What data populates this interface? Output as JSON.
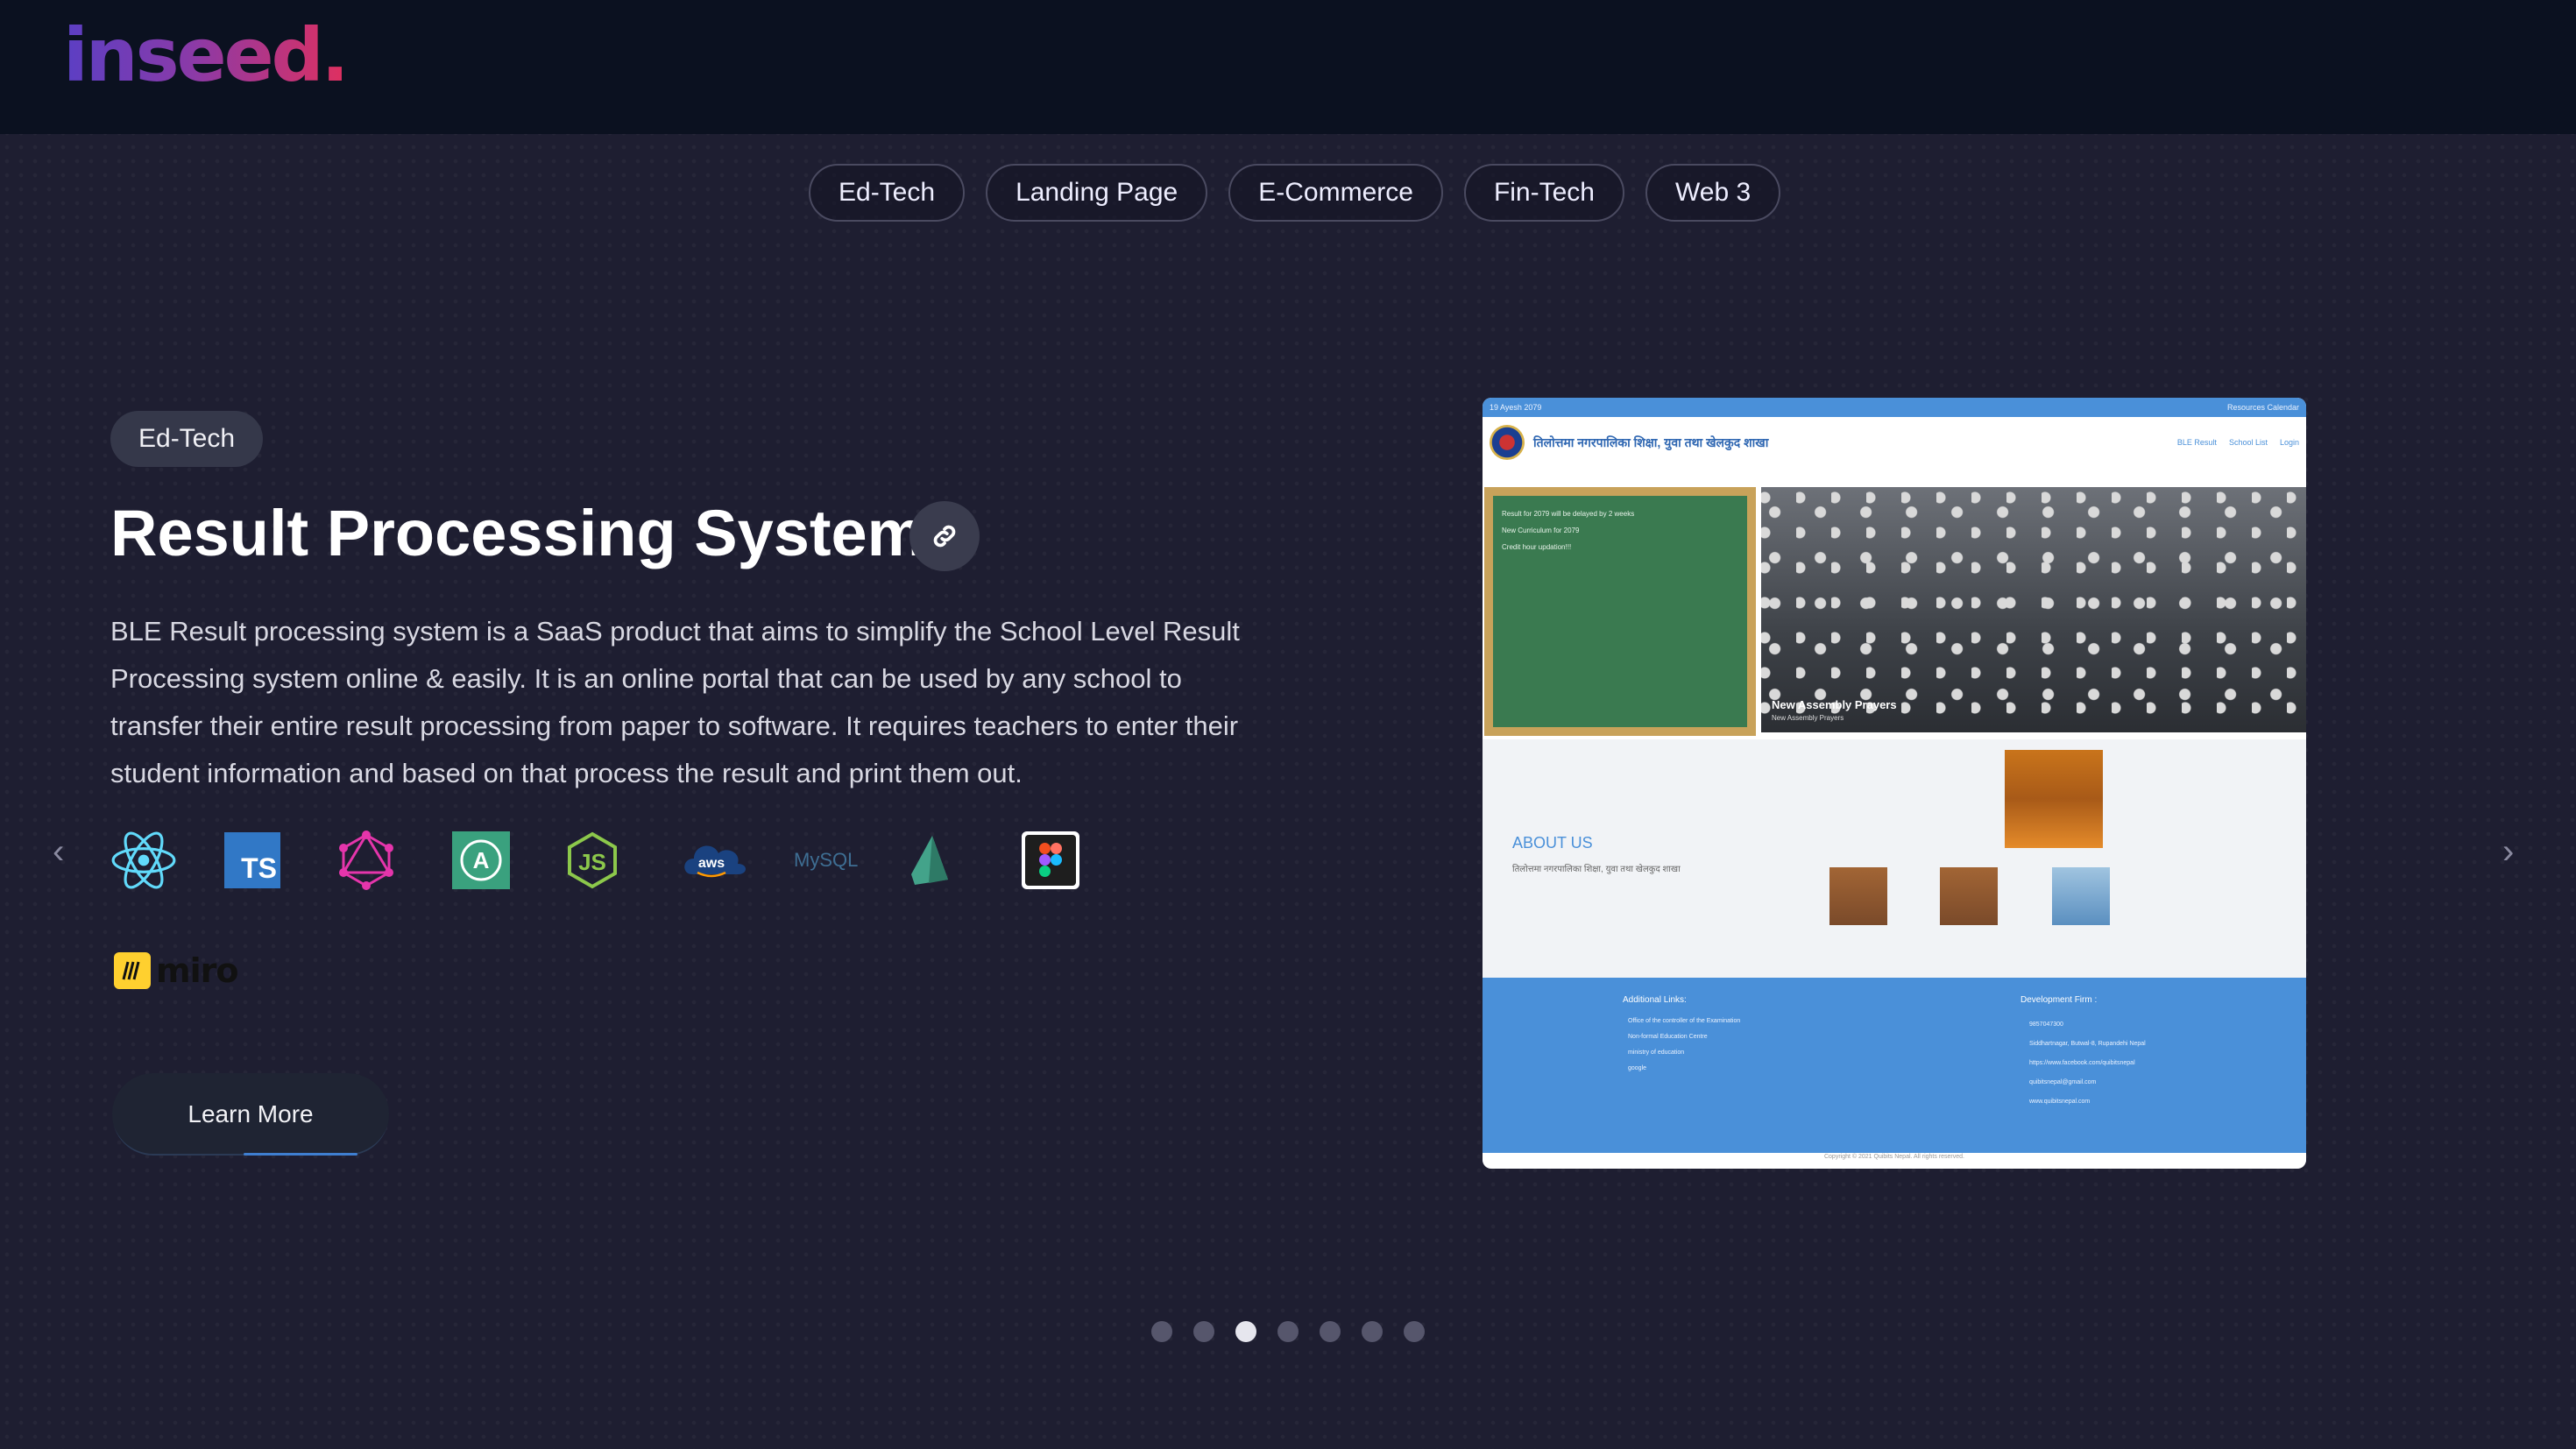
{
  "brand": {
    "logo_text": "inseed."
  },
  "filters": [
    "Ed-Tech",
    "Landing Page",
    "E-Commerce",
    "Fin-Tech",
    "Web 3"
  ],
  "project": {
    "tag": "Ed-Tech",
    "title": "Result Processing System",
    "description": "BLE Result processing system is a SaaS product that aims to simplify the School Level Result Processing system online & easily. It is an online portal that can be used by any school to transfer their entire result processing from paper to software. It requires teachers to enter their student information and based on that process the result and print them out.",
    "tech_icons": [
      "react-icon",
      "typescript-icon",
      "graphql-icon",
      "apollo-icon",
      "nodejs-icon",
      "aws-icon",
      "mysql-icon",
      "prisma-icon",
      "figma-icon"
    ],
    "ts_label": "TS",
    "aws_label": "aws",
    "mysql_label": "MySQL",
    "miro_label": "miro",
    "cta_label": "Learn More"
  },
  "carousel": {
    "total": 7,
    "active_index": 2
  },
  "preview": {
    "date": "19 Ayesh 2079",
    "top_links": "Resources  Calendar",
    "org_name": "तिलोत्तमा नगरपालिका शिक्षा, युवा तथा खेलकुद शाखा",
    "nav": [
      "BLE Result",
      "School List",
      "Login"
    ],
    "notices": [
      "Result for 2079 will be delayed by 2 weeks",
      "New Curriculum for 2079",
      "Credit hour updation!!!"
    ],
    "hero_caption": "New Assembly Prayers",
    "hero_sub": "New Assembly Prayers",
    "about_title": "ABOUT US",
    "about_sub": "तिलोत्तमा नगरपालिका शिक्षा, युवा तथा खेलकुद शाखा",
    "footer_links_title": "Additional Links:",
    "footer_links": [
      "Office of the controller of the Examination",
      "Non-formal Education Centre",
      "ministry of education",
      "google"
    ],
    "footer_dev_title": "Development Firm :",
    "footer_dev": [
      "9857047300",
      "Siddhartnagar, Butwal-8, Rupandehi Nepal",
      "https://www.facebook.com/quibitsnepal",
      "quibitsnepal@gmail.com",
      "www.quibitsnepal.com"
    ],
    "copyright": "Copyright © 2021 Quibits Nepal. All rights reserved."
  }
}
